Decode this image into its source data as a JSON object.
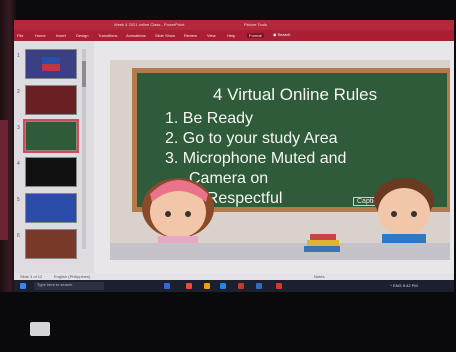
{
  "window": {
    "title": "Week 4 2021 online Class - PowerPoint",
    "picture_tools": "Picture Tools"
  },
  "ribbon": {
    "tabs": [
      "File",
      "Home",
      "Insert",
      "Design",
      "Transitions",
      "Animations",
      "Slide Show",
      "Review",
      "View",
      "Help",
      "Format"
    ],
    "search": "Search"
  },
  "thumbnails": [
    {
      "num": "1",
      "color": "#3b3f84"
    },
    {
      "num": "2",
      "color": "#6a1f22"
    },
    {
      "num": "3",
      "color": "#2f5b3b"
    },
    {
      "num": "4",
      "color": "#111111"
    },
    {
      "num": "5",
      "color": "#2b4ca8"
    },
    {
      "num": "6",
      "color": "#7a3a2a"
    }
  ],
  "slide": {
    "title": "4 Virtual Online Rules",
    "rules": [
      "1. Be Ready",
      "2. Go to your study Area",
      "3. Microphone Muted and",
      "4. Be Respectful"
    ],
    "rule3_cont": "Camera on",
    "caption": "Caption/Alt text"
  },
  "statusbar": {
    "slide_info": "Slide 3 of 12",
    "lang": "English (Philippines)",
    "notes": "Notes"
  },
  "taskbar": {
    "search_placeholder": "Type here to search",
    "tray": "^ ENG 9:42 PM"
  }
}
